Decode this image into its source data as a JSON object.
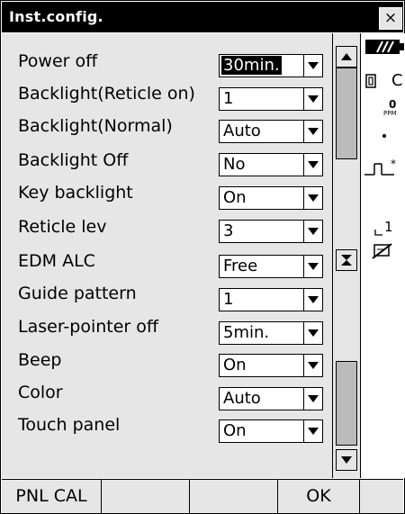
{
  "window": {
    "title": "Inst.config.",
    "close_label": "×"
  },
  "settings": [
    {
      "label": "Power off",
      "value": "30min."
    },
    {
      "label": "Backlight(Reticle on)",
      "value": "1"
    },
    {
      "label": "Backlight(Normal)",
      "value": "Auto"
    },
    {
      "label": "Backlight Off",
      "value": "No"
    },
    {
      "label": "Key backlight",
      "value": "On"
    },
    {
      "label": "Reticle lev",
      "value": "3"
    },
    {
      "label": "EDM ALC",
      "value": "Free"
    },
    {
      "label": "Guide pattern",
      "value": "1"
    },
    {
      "label": "Laser-pointer off",
      "value": "5min."
    },
    {
      "label": "Beep",
      "value": "On"
    },
    {
      "label": "Color",
      "value": "Auto"
    },
    {
      "label": "Touch panel",
      "value": "On"
    }
  ],
  "status_panel": {
    "battery_icon": "battery-icon",
    "ppm_value": "0",
    "ppm_label": "PPM",
    "target_icon": "target-icon",
    "reflector_icon": "reflector-icon",
    "step_value": "1",
    "disk_icon": "disk-icon",
    "cut_text": "C"
  },
  "softkeys": {
    "pnl_cal": "PNL CAL",
    "ok": "OK"
  },
  "colors": {
    "titlebar": "#000000",
    "panel": "#e6e6e6",
    "field": "#ffffff",
    "selected": "#000000"
  }
}
